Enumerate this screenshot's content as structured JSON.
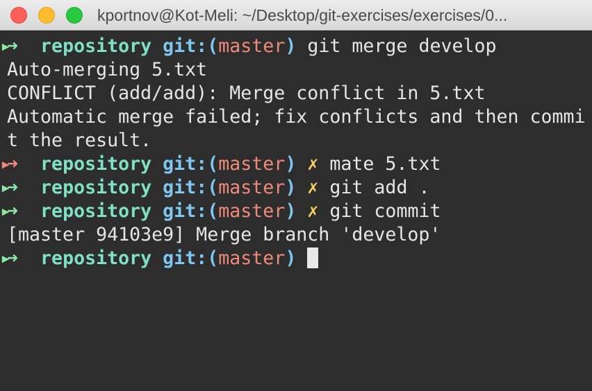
{
  "window": {
    "title": "kportnov@Kot-Meli: ~/Desktop/git-exercises/exercises/0..."
  },
  "colors": {
    "background": "#2d2d2d",
    "prompt_ok": "#8ee8a5",
    "prompt_fail": "#f08a7a",
    "repo": "#7fe0c2",
    "git": "#7fc7f0",
    "branch": "#f08a7a",
    "dirty": "#f4d35e"
  },
  "prompt": {
    "arrow": "➜",
    "repo": "repository",
    "git_open": "git:(",
    "branch": "master",
    "git_close": ")",
    "dirty_mark": "✗"
  },
  "lines": [
    {
      "type": "prompt",
      "status": "ok",
      "dirty": false,
      "command": "git merge develop"
    },
    {
      "type": "output",
      "text": "Auto-merging 5.txt"
    },
    {
      "type": "output",
      "text": "CONFLICT (add/add): Merge conflict in 5.txt"
    },
    {
      "type": "output",
      "text": "Automatic merge failed; fix conflicts and then commi"
    },
    {
      "type": "output",
      "text": "t the result."
    },
    {
      "type": "prompt",
      "status": "fail",
      "dirty": true,
      "command": "mate 5.txt"
    },
    {
      "type": "prompt",
      "status": "ok",
      "dirty": true,
      "command": "git add ."
    },
    {
      "type": "prompt",
      "status": "ok",
      "dirty": true,
      "command": "git commit"
    },
    {
      "type": "output",
      "text": "[master 94103e9] Merge branch 'develop'"
    },
    {
      "type": "prompt",
      "status": "ok",
      "dirty": false,
      "command": "",
      "cursor": true
    }
  ]
}
